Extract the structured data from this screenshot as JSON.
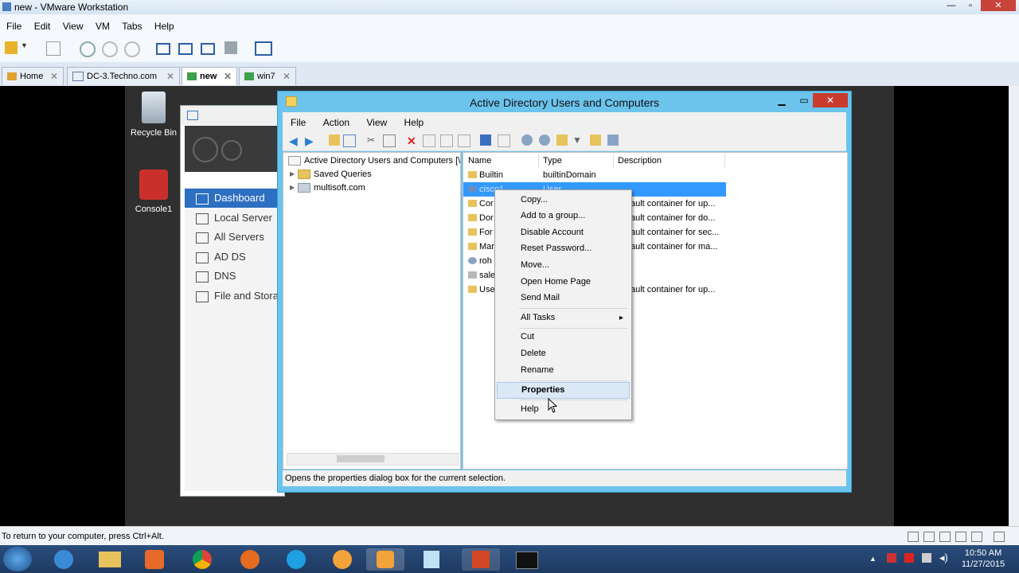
{
  "vmware": {
    "title": "new - VMware Workstation",
    "window_controls": [
      "—",
      "▫",
      "✕"
    ],
    "menu": [
      "File",
      "Edit",
      "View",
      "VM",
      "Tabs",
      "Help"
    ],
    "tabs": [
      {
        "label": "Home"
      },
      {
        "label": "DC-3.Techno.com"
      },
      {
        "label": "new"
      },
      {
        "label": "win7"
      }
    ],
    "status_text": "To return to your computer, press Ctrl+Alt."
  },
  "desktop": {
    "icons": [
      {
        "label": "Recycle Bin",
        "icon": "recycle-bin-icon"
      },
      {
        "label": "Console1",
        "icon": "toolbox-icon"
      }
    ]
  },
  "server_manager": {
    "items": [
      {
        "label": "Dashboard",
        "icon": "dashboard-icon"
      },
      {
        "label": "Local Server",
        "icon": "server-icon"
      },
      {
        "label": "All Servers",
        "icon": "servers-icon"
      },
      {
        "label": "AD DS",
        "icon": "ad-icon"
      },
      {
        "label": "DNS",
        "icon": "dns-icon"
      },
      {
        "label": "File and Stora",
        "icon": "file-storage-icon"
      }
    ]
  },
  "ad_window": {
    "title": "Active Directory Users and Computers",
    "menu": [
      "File",
      "Action",
      "View",
      "Help"
    ],
    "tree": [
      {
        "label": "Active Directory Users and Computers [\\"
      },
      {
        "label": "Saved Queries"
      },
      {
        "label": "multisoft.com"
      }
    ],
    "columns": [
      "Name",
      "Type",
      "Description"
    ],
    "rows": [
      {
        "name": "Builtin",
        "type": "builtinDomain",
        "desc": ""
      },
      {
        "name": "cisco1",
        "type": "User",
        "desc": ""
      },
      {
        "name": "Cor",
        "type": "",
        "desc": "ault container for up..."
      },
      {
        "name": "Dor",
        "type": "",
        "desc": "ault container for do..."
      },
      {
        "name": "For",
        "type": "",
        "desc": "ault container for sec..."
      },
      {
        "name": "Mar",
        "type": "",
        "desc": "ault container for ma..."
      },
      {
        "name": "roh",
        "type": "",
        "desc": ""
      },
      {
        "name": "sale",
        "type": "",
        "desc": ""
      },
      {
        "name": "Use",
        "type": "",
        "desc": "ault container for up..."
      }
    ],
    "status": "Opens the properties dialog box for the current selection."
  },
  "context_menu": {
    "items": [
      "Copy...",
      "Add to a group...",
      "Disable Account",
      "Reset Password...",
      "Move...",
      "Open Home Page",
      "Send Mail",
      "All Tasks",
      "Cut",
      "Delete",
      "Rename",
      "Properties",
      "Help"
    ],
    "submenu_arrow": "▸"
  },
  "taskbar": {
    "time": "10:50 AM",
    "date": "11/27/2015"
  },
  "colors": {
    "selection": "#3399ff",
    "ad_frame": "#6cc3ec",
    "dashboard_active": "#2d6fc0",
    "close_button": "#c83b2e"
  }
}
